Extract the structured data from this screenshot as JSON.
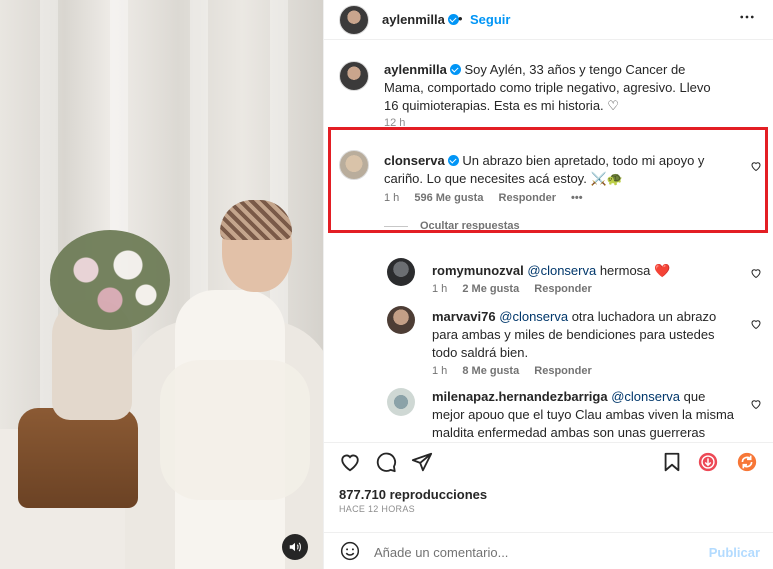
{
  "post": {
    "author": "aylenmilla",
    "follow_label": "Seguir",
    "more_label": "•••",
    "caption": {
      "username": "aylenmilla",
      "text": "Soy Aylén, 33 años y tengo Cancer de Mama, comportado como triple negativo, agresivo. Llevo 16 quimioterapias. Esta es mi historia. ♡",
      "time": "12 h"
    }
  },
  "comments": [
    {
      "username": "clonserva",
      "verified": true,
      "text": "Un abrazo bien apretado, todo mi apoyo y cariño. Lo que necesites acá estoy. ⚔️🐢",
      "time": "1 h",
      "likes": "596 Me gusta",
      "reply_label": "Responder",
      "options_label": "•••",
      "hide_replies": "Ocultar respuestas",
      "replies": [
        {
          "username": "romymunozval",
          "mention": "@clonserva",
          "text": " hermosa ❤️",
          "time": "1 h",
          "likes": "2 Me gusta",
          "reply_label": "Responder"
        },
        {
          "username": "marvavi76",
          "mention": "@clonserva",
          "text": " otra luchadora un abrazo para ambas y miles de bendiciones para ustedes todo saldrá bien.",
          "time": "1 h",
          "likes": "8 Me gusta",
          "reply_label": "Responder"
        },
        {
          "username": "milenapaz.hernandezbarriga",
          "mention": "@clonserva",
          "text": " que mejor apouo que el tuyo Clau ambas viven la misma maldita enfermedad ambas son unas guerreras Vikingas un",
          "time": "",
          "likes": "",
          "reply_label": ""
        }
      ]
    }
  ],
  "stats": {
    "views": "877.710 reproducciones",
    "posted_ago": "HACE 12 HORAS"
  },
  "composer": {
    "placeholder": "Añade un comentario...",
    "post_label": "Publicar"
  },
  "colors": {
    "accent": "#0095f6",
    "highlight": "#e31e24",
    "heart_red": "#ed4956"
  }
}
